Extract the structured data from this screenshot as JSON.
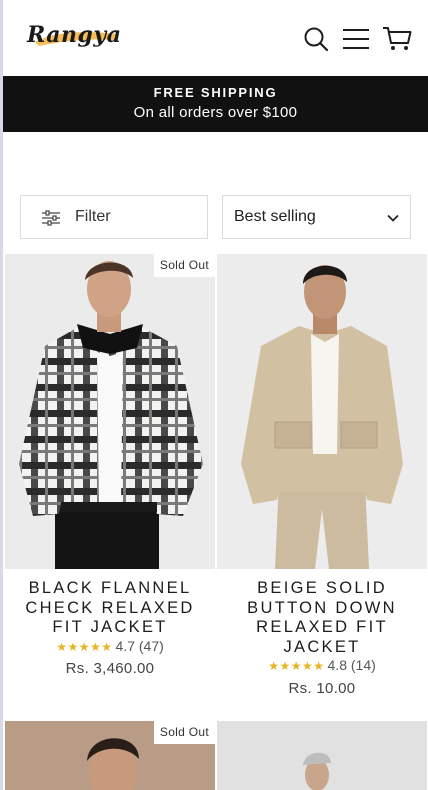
{
  "header": {
    "logo_text": "Rangya",
    "icons": [
      "search-icon",
      "menu-icon",
      "cart-icon"
    ]
  },
  "announcement": {
    "title": "FREE SHIPPING",
    "subtitle": "On all orders over $100"
  },
  "toolbar": {
    "filter_label": "Filter",
    "sort_value": "Best selling"
  },
  "products": [
    {
      "badge": "Sold Out",
      "title_lines": [
        "BLACK FLANNEL",
        "CHECK RELAXED",
        "FIT JACKET"
      ],
      "stars": "★★★★★",
      "rating": "4.7",
      "reviews": "(47)",
      "price": "Rs. 3,460.00"
    },
    {
      "badge": "",
      "title_lines": [
        "BEIGE SOLID",
        "BUTTON DOWN",
        "RELAXED FIT",
        "JACKET"
      ],
      "stars": "★★★★★",
      "rating": "4.8",
      "reviews": "(14)",
      "price": "Rs. 10.00"
    },
    {
      "badge": "Sold Out"
    },
    {
      "badge": ""
    }
  ],
  "colors": {
    "announcement_bg": "#111111",
    "star": "#e6b422",
    "logo_swash": "#f2b13a"
  }
}
